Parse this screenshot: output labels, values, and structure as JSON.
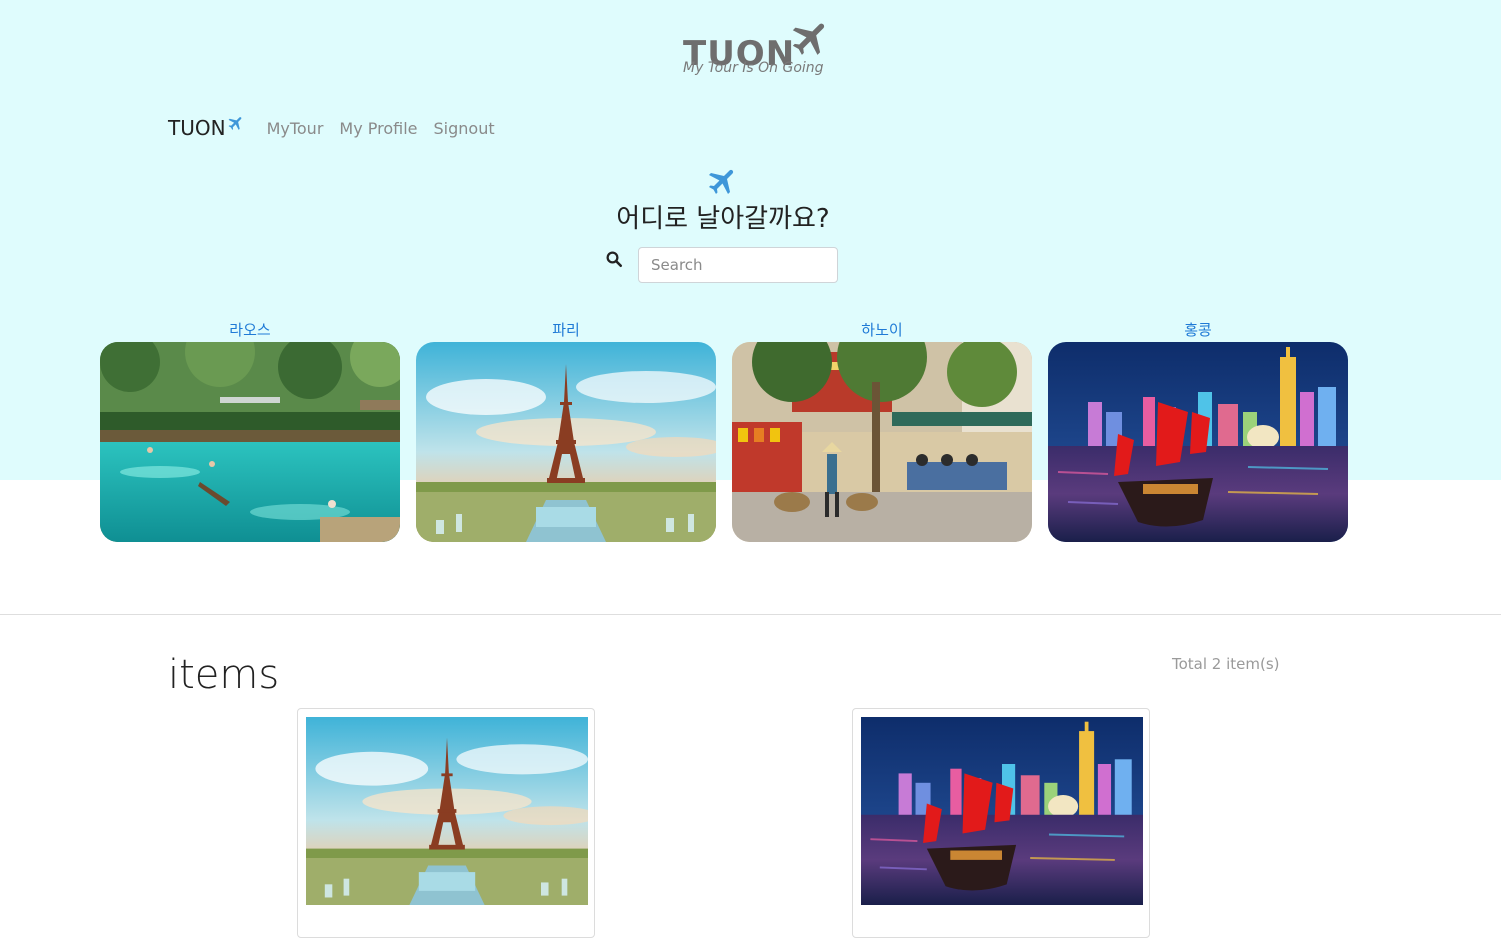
{
  "logo": {
    "word": "TUON",
    "tagline": "My Tour Is On Going"
  },
  "nav": {
    "brand": "TUON",
    "links": [
      "MyTour",
      "My Profile",
      "Signout"
    ]
  },
  "hero": {
    "title": "어디로 날아갈까요?",
    "search_placeholder": "Search"
  },
  "destinations": [
    {
      "label": "라오스",
      "image": "laos-turquoise-lagoon"
    },
    {
      "label": "파리",
      "image": "paris-eiffel-tower"
    },
    {
      "label": "하노이",
      "image": "hanoi-street-market"
    },
    {
      "label": "홍콩",
      "image": "hong-kong-harbour-junk-boat"
    }
  ],
  "items": {
    "title": "items",
    "total": "Total 2 item(s)",
    "cards": [
      {
        "image": "paris-eiffel-tower"
      },
      {
        "image": "hong-kong-harbour-junk-boat"
      }
    ]
  },
  "colors": {
    "hero_bg": "#dffcfd",
    "link_blue": "#1f7ad6",
    "plane_blue": "#3f97d9",
    "logo_gray": "#6e6e6e"
  }
}
